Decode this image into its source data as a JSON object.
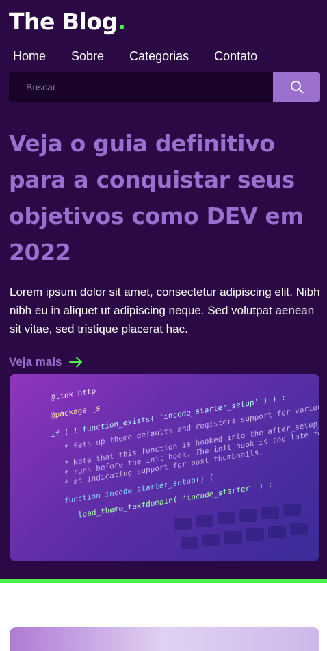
{
  "brand": {
    "name": "The Blog",
    "dot": "."
  },
  "nav": {
    "items": [
      {
        "label": "Home"
      },
      {
        "label": "Sobre"
      },
      {
        "label": "Categorias"
      },
      {
        "label": "Contato"
      }
    ]
  },
  "search": {
    "placeholder": "Buscar",
    "value": "",
    "icon": "search-icon"
  },
  "featured": {
    "title": "Veja o guia definitivo para a conquistar seus objetivos como DEV em 2022",
    "excerpt": "Lorem ipsum dolor sit amet, consectetur adipiscing elit. Nibh nibh eu in aliquet ut adipiscing neque. Sed volutpat aenean sit vitae, sed tristique placerat hac.",
    "read_more": "Veja mais",
    "read_more_icon": "arrow-right-icon"
  },
  "code_image": {
    "lines": [
      "@link http",
      "@package _s",
      "if ( ! function_exists( 'incode_starter_setup' ) ) :",
      "* Sets up theme defaults and registers support for various",
      "* Note that this function is hooked into the after_setup_theme hook",
      "* runs before the init hook. The init hook is too late for some features",
      "* as indicating support for post thumbnails.",
      "function incode_starter_setup() {",
      "load_theme_textdomain( 'incode_starter' ) ;"
    ]
  },
  "colors": {
    "background": "#2a0944",
    "accent": "#9b6fd0",
    "highlight": "#4cf04c",
    "search_bg": "#1a0329",
    "text": "#ffffff"
  }
}
